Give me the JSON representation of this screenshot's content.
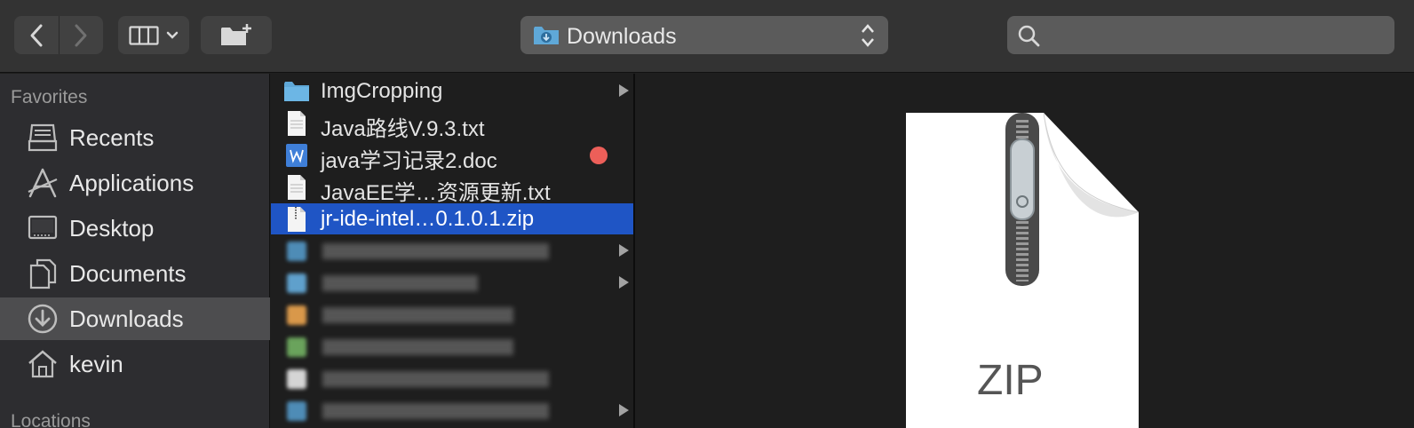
{
  "toolbar": {
    "path_label": "Downloads",
    "search_placeholder": ""
  },
  "sidebar": {
    "favorites_header": "Favorites",
    "locations_header": "Locations",
    "items": [
      {
        "label": "Recents",
        "icon": "recents-icon"
      },
      {
        "label": "Applications",
        "icon": "applications-icon"
      },
      {
        "label": "Desktop",
        "icon": "desktop-icon"
      },
      {
        "label": "Documents",
        "icon": "documents-icon"
      },
      {
        "label": "Downloads",
        "icon": "downloads-icon",
        "selected": true
      },
      {
        "label": "kevin",
        "icon": "home-icon"
      }
    ]
  },
  "files": [
    {
      "name": "ImgCropping",
      "kind": "folder",
      "has_children": true
    },
    {
      "name": "Java路线V.9.3.txt",
      "kind": "text"
    },
    {
      "name": "java学习记录2.doc",
      "kind": "word",
      "tag_color": "#ec5f59"
    },
    {
      "name": "JavaEE学…资源更新.txt",
      "kind": "text"
    },
    {
      "name": "jr-ide-intel…0.1.0.1.zip",
      "kind": "zip",
      "selected": true
    }
  ],
  "preview": {
    "file_type_label": "ZIP"
  },
  "colors": {
    "selection": "#1f55c5",
    "sidebar_selection": "#4d4d4f",
    "folder_blue": "#5fa8d8",
    "red_tag": "#ec5f59"
  }
}
